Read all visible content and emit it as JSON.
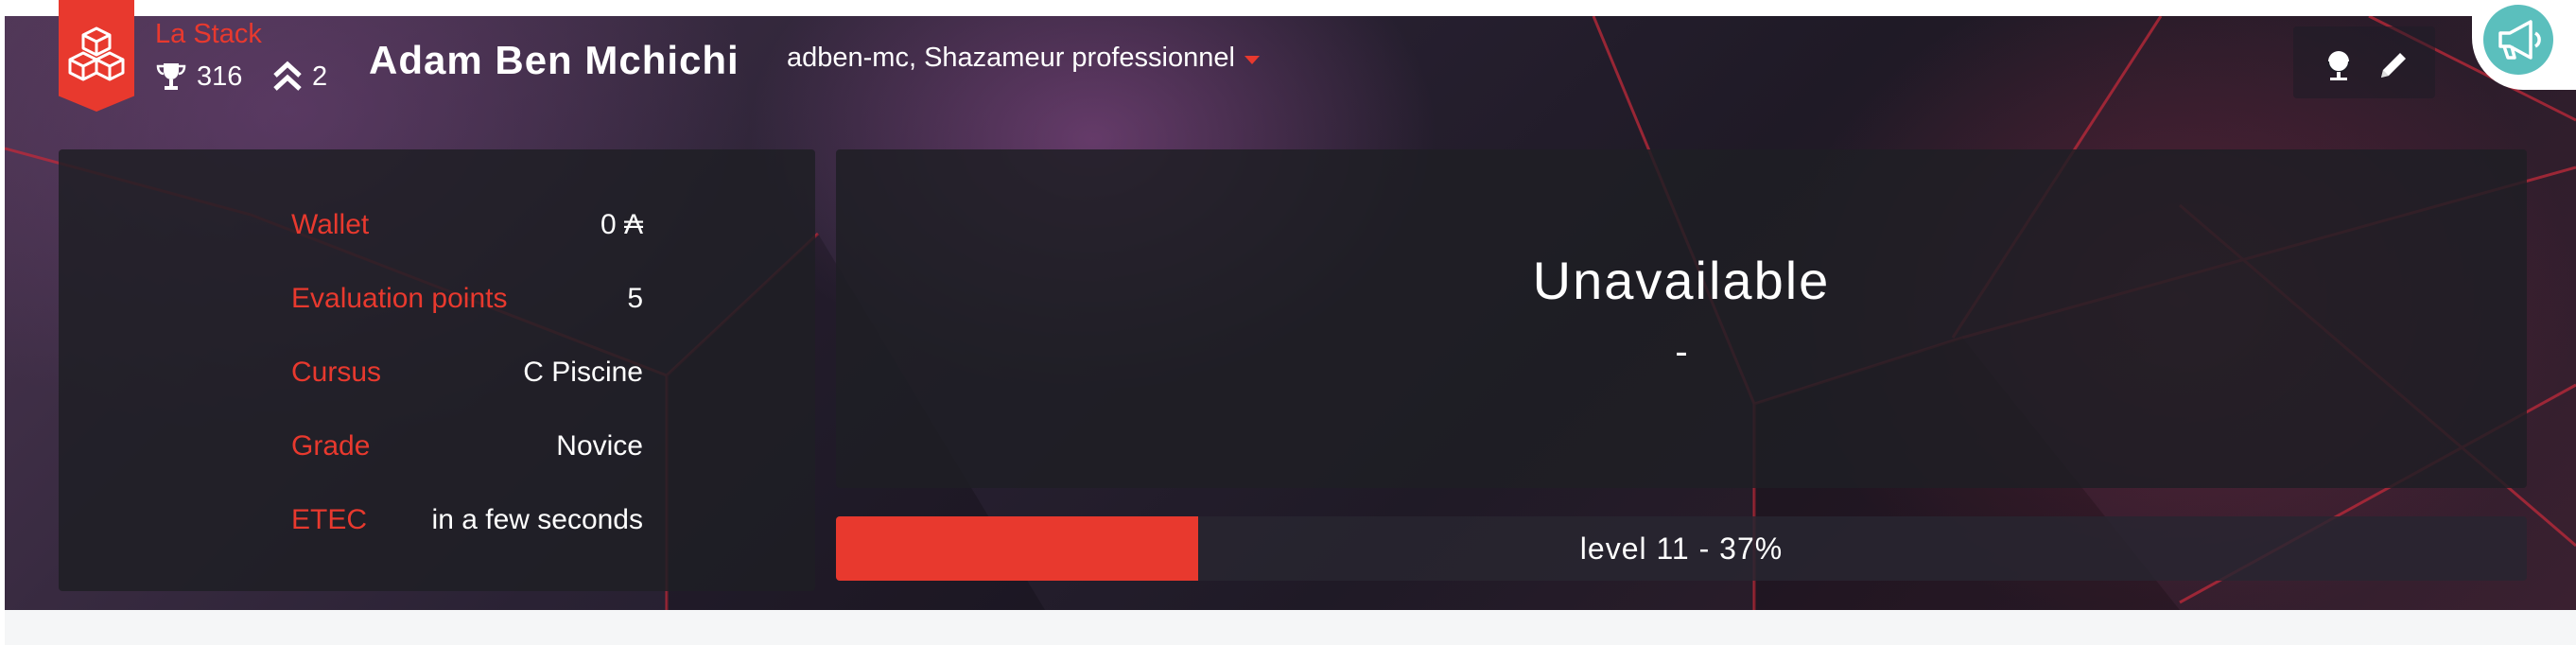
{
  "coalition": {
    "name": "La Stack",
    "trophies": "316",
    "rank_level": "2",
    "color": "#e8392e",
    "icon": "cubes-icon"
  },
  "user": {
    "display_name": "Adam Ben Mchichi",
    "login_title": "adben-mc, Shazameur professionnel"
  },
  "tools": {
    "globe_icon": "globe-icon",
    "edit_icon": "pencil-icon",
    "announcement_icon": "megaphone-icon",
    "announcement_color": "#5bbfbd"
  },
  "info": [
    {
      "label": "Wallet",
      "value": "0 ₳"
    },
    {
      "label": "Evaluation points",
      "value": "5"
    },
    {
      "label": "Cursus",
      "value": "C Piscine"
    },
    {
      "label": "Grade",
      "value": "Novice"
    },
    {
      "label": "ETEC",
      "value": "in a few seconds"
    }
  ],
  "main": {
    "title": "Unavailable",
    "subtitle": "-"
  },
  "level": {
    "text": "level 11 - 37%",
    "progress": 0.214
  }
}
